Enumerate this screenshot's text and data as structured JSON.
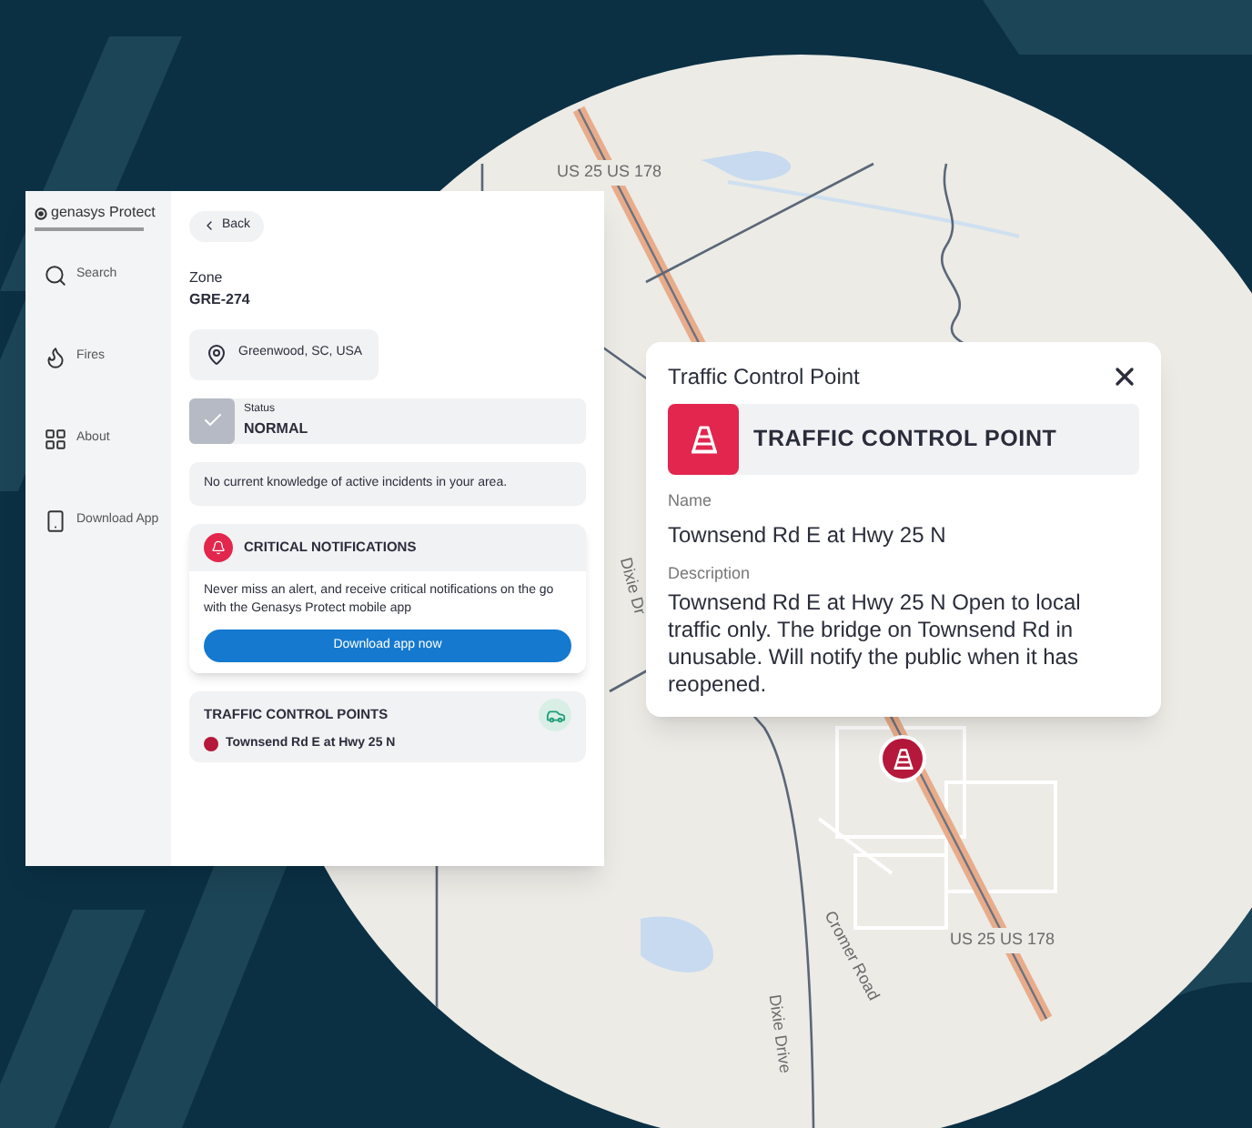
{
  "app": {
    "logo": "genasys Protect",
    "nav": [
      {
        "kind": "search",
        "label": "Search"
      },
      {
        "kind": "fires",
        "label": "Fires"
      },
      {
        "kind": "about",
        "label": "About"
      },
      {
        "kind": "download",
        "label": "Download App"
      }
    ],
    "back": "Back",
    "zone_label": "Zone",
    "zone": "GRE-274",
    "location": "Greenwood, SC, USA",
    "status_label": "Status",
    "status": "NORMAL",
    "note": "No current knowledge of active incidents in your area.",
    "notifications": {
      "title": "CRITICAL NOTIFICATIONS",
      "body": "Never miss an alert, and receive critical notifications on the go with the Genasys Protect mobile app",
      "button": "Download app now"
    },
    "traffic": {
      "title": "TRAFFIC CONTROL POINTS",
      "items": [
        "Townsend Rd E at Hwy 25 N"
      ]
    }
  },
  "map": {
    "labels": [
      "US 25 US 178",
      "Dixie Dr",
      "Cromer Road",
      "US 25 US 178",
      "Dixie Drive"
    ]
  },
  "popup": {
    "header": "Traffic Control Point",
    "banner": "TRAFFIC CONTROL POINT",
    "name_label": "Name",
    "name": "Townsend Rd E at Hwy 25 N",
    "description_label": "Description",
    "description": "Townsend Rd E at Hwy 25 N Open to local traffic only. The bridge on Townsend Rd in unusable. Will notify the public when it has reopened."
  }
}
